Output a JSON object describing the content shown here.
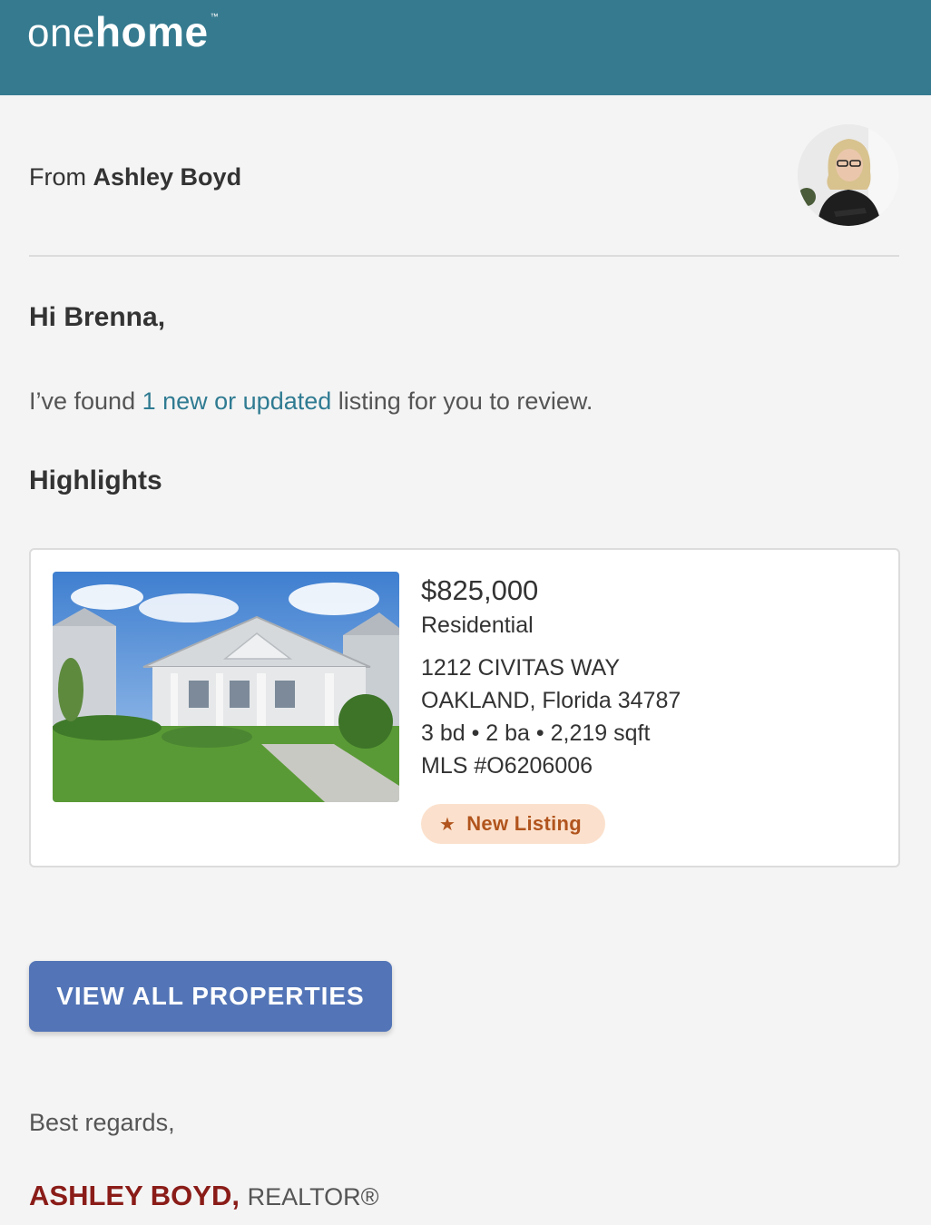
{
  "header": {
    "logo_part1": "one",
    "logo_part2": "home",
    "logo_tm": "™",
    "bg_color": "#367a8f"
  },
  "sender": {
    "prefix": "From",
    "name": "Ashley Boyd",
    "avatar_icon": "agent-photo"
  },
  "message": {
    "greeting": "Hi Brenna,",
    "intro_before": "I’ve found",
    "intro_link": "1 new or updated",
    "intro_after": "listing for you to review.",
    "section_title": "Highlights"
  },
  "listing": {
    "price": "$825,000",
    "type": "Residential",
    "street": "1212 CIVITAS WAY",
    "city_line": "OAKLAND, Florida 34787",
    "specs": "3 bd • 2 ba • 2,219 sqft",
    "mls": "MLS #O6206006",
    "badge_icon": "★",
    "badge_label": "New Listing",
    "photo_icon": "house-photo"
  },
  "cta": {
    "label": "VIEW ALL PROPERTIES",
    "color": "#5375b7"
  },
  "closing": {
    "regards": "Best regards,",
    "signature_name": "ASHLEY BOYD,",
    "signature_title": "REALTOR®"
  }
}
